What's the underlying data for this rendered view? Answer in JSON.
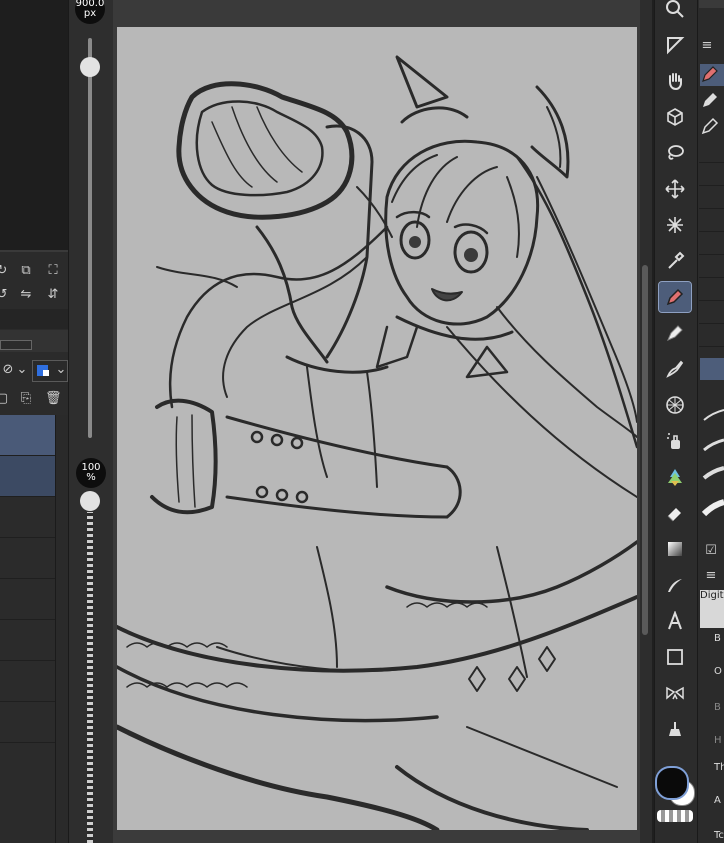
{
  "slider": {
    "size_value": "900.0",
    "size_unit": "px",
    "opacity_value": "100",
    "opacity_unit": "%"
  },
  "toolbar": {
    "tools": [
      {
        "name": "zoom"
      },
      {
        "name": "operation"
      },
      {
        "name": "hand"
      },
      {
        "name": "3d-object"
      },
      {
        "name": "lasso"
      },
      {
        "name": "move"
      },
      {
        "name": "auto-select"
      },
      {
        "name": "eyedropper"
      },
      {
        "name": "pen",
        "active": true
      },
      {
        "name": "pencil"
      },
      {
        "name": "brush"
      },
      {
        "name": "perspective"
      },
      {
        "name": "airbrush"
      },
      {
        "name": "decoration"
      },
      {
        "name": "eraser"
      },
      {
        "name": "gradient"
      },
      {
        "name": "blend"
      },
      {
        "name": "text"
      },
      {
        "name": "figure"
      },
      {
        "name": "frame"
      },
      {
        "name": "fill"
      }
    ]
  },
  "right_panel": {
    "header_label": "Digita",
    "prop_labels": [
      "B",
      "O",
      "B",
      "H",
      "Th",
      "A",
      "Tc"
    ]
  },
  "colors": {
    "main": "#0a0a0a",
    "sub": "#ffffff",
    "accent": "#4d5d7a",
    "pen_highlight": "#e07070"
  }
}
